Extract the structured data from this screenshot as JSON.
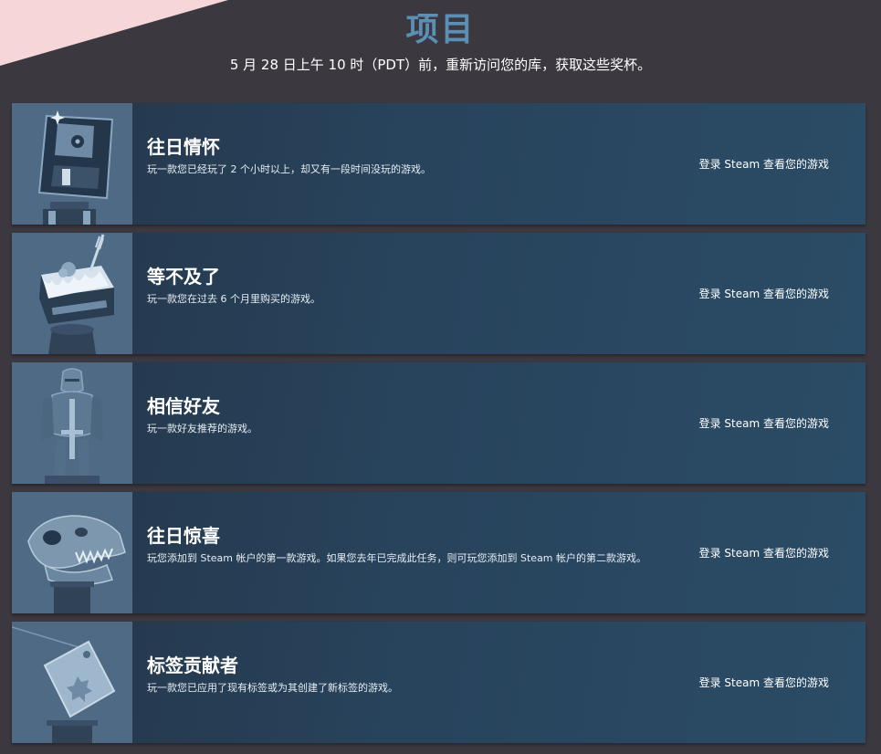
{
  "header": {
    "title": "项目",
    "subtitle": "5 月 28 日上午 10 时（PDT）前，重新访问您的库，获取这些奖杯。"
  },
  "quests": [
    {
      "title": "往日情怀",
      "description": "玩一款您已经玩了 2 个小时以上，却又有一段时间没玩的游戏。",
      "login_label": "登录 Steam 查看您的游戏",
      "icon": "floppy-disk-trophy-icon"
    },
    {
      "title": "等不及了",
      "description": "玩一款您在过去 6 个月里购买的游戏。",
      "login_label": "登录 Steam 查看您的游戏",
      "icon": "cake-trophy-icon"
    },
    {
      "title": "相信好友",
      "description": "玩一款好友推荐的游戏。",
      "login_label": "登录 Steam 查看您的游戏",
      "icon": "knight-trophy-icon"
    },
    {
      "title": "往日惊喜",
      "description": "玩您添加到 Steam 帐户的第一款游戏。如果您去年已完成此任务，则可玩您添加到 Steam 帐户的第二款游戏。",
      "login_label": "登录 Steam 查看您的游戏",
      "icon": "dinosaur-skull-trophy-icon"
    },
    {
      "title": "标签贡献者",
      "description": "玩一款您已应用了现有标签或为其创建了新标签的游戏。",
      "login_label": "登录 Steam 查看您的游戏",
      "icon": "price-tag-trophy-icon"
    }
  ],
  "colors": {
    "background": "#3b3840",
    "title_accent": "#5a8fb6",
    "corner_ribbon": "#f6d6d8",
    "row_gradient_start": "#243649",
    "row_gradient_end": "#2b4c66",
    "art_background": "#4f6a85"
  }
}
